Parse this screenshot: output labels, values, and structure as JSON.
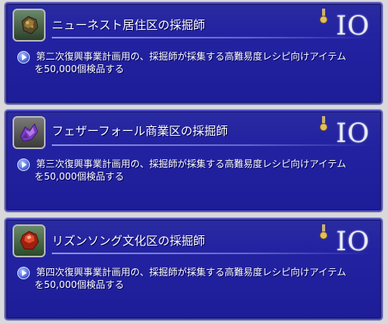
{
  "entries": [
    {
      "title": "ニューネスト居住区の採掘師",
      "desc_line1": "第二次復興事業計画用の、採掘師が採集する高難易度レシピ向けアイテム",
      "desc_line2": "を50,000個検品する",
      "count": "IO",
      "icon": "ore-icon",
      "icon_color": "#7a6a40"
    },
    {
      "title": "フェザーフォール商業区の採掘師",
      "desc_line1": "第三次復興事業計画用の、採掘師が採集する高難易度レシピ向けアイテム",
      "desc_line2": "を50,000個検品する",
      "count": "IO",
      "icon": "crystal-icon",
      "icon_color": "#8a4ac8"
    },
    {
      "title": "リズンソング文化区の採掘師",
      "desc_line1": "第四次復興事業計画用の、採掘師が採集する高難易度レシピ向けアイテム",
      "desc_line2": "を50,000個検品する",
      "count": "IO",
      "icon": "red-gem-icon",
      "icon_color": "#c03018"
    }
  ]
}
